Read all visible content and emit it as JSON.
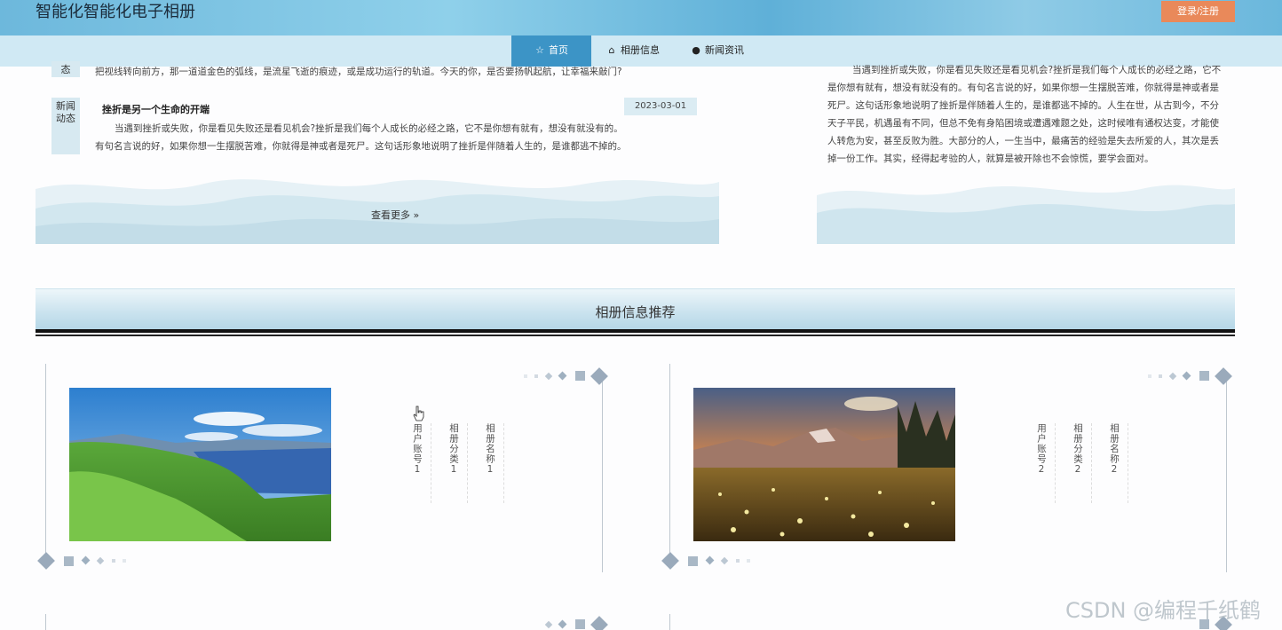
{
  "header": {
    "site_title": "智能化智能化电子相册",
    "login_label": "登录/注册"
  },
  "nav": [
    {
      "label": "首页",
      "icon": "star-icon",
      "active": true
    },
    {
      "label": "相册信息",
      "icon": "lock-icon",
      "active": false
    },
    {
      "label": "新闻资讯",
      "icon": "info-icon",
      "active": false
    }
  ],
  "news": {
    "tag_top_partial": "态",
    "first_text": "把视线转向前方，那一道道金色的弧线，是流星飞逝的痕迹，或是成功运行的轨道。今天的你，是否要扬帆起航，让幸福来敲门?",
    "tag_label": "新闻动态",
    "item_title": "挫折是另一个生命的开端",
    "item_date": "2023-03-01",
    "item_text_1": "当遇到挫折或失败，你是看见失败还是看见机会?挫折是我们每个人成长的必经之路，它不是你想有就有，想没有就没有的。",
    "item_text_2": "有句名言说的好，如果你想一生摆脱苦难，你就得是神或者是死尸。这句话形象地说明了挫折是伴随着人生的，是谁都逃不掉的。",
    "more_label": "查看更多"
  },
  "right_panel": {
    "text": "当遇到挫折或失败，你是看见失败还是看见机会?挫折是我们每个人成长的必经之路，它不是你想有就有，想没有就没有的。有句名言说的好，如果你想一生摆脱苦难，你就得是神或者是死尸。这句话形象地说明了挫折是伴随着人生的，是谁都逃不掉的。人生在世，从古到今，不分天子平民，机遇虽有不同，但总不免有身陷困境或遭遇难题之处，这时候唯有通权达变，才能使人转危为安，甚至反败为胜。大部分的人，一生当中，最痛苦的经验是失去所爱的人，其次是丢掉一份工作。其实，经得起考验的人，就算是被开除也不会惊慌，要学会面对。"
  },
  "recommend": {
    "title": "相册信息推荐",
    "cards": [
      {
        "image": "lake-landscape",
        "user_account": "用户账号1",
        "category": "相册分类1",
        "name": "相册名称1"
      },
      {
        "image": "mountain-flower-meadow",
        "user_account": "用户账号2",
        "category": "相册分类2",
        "name": "相册名称2"
      }
    ]
  },
  "watermark": "CSDN @编程千纸鹤",
  "colors": {
    "nav_active": "#3c94c6",
    "login": "#e9895a",
    "header": "#6db8dc"
  }
}
